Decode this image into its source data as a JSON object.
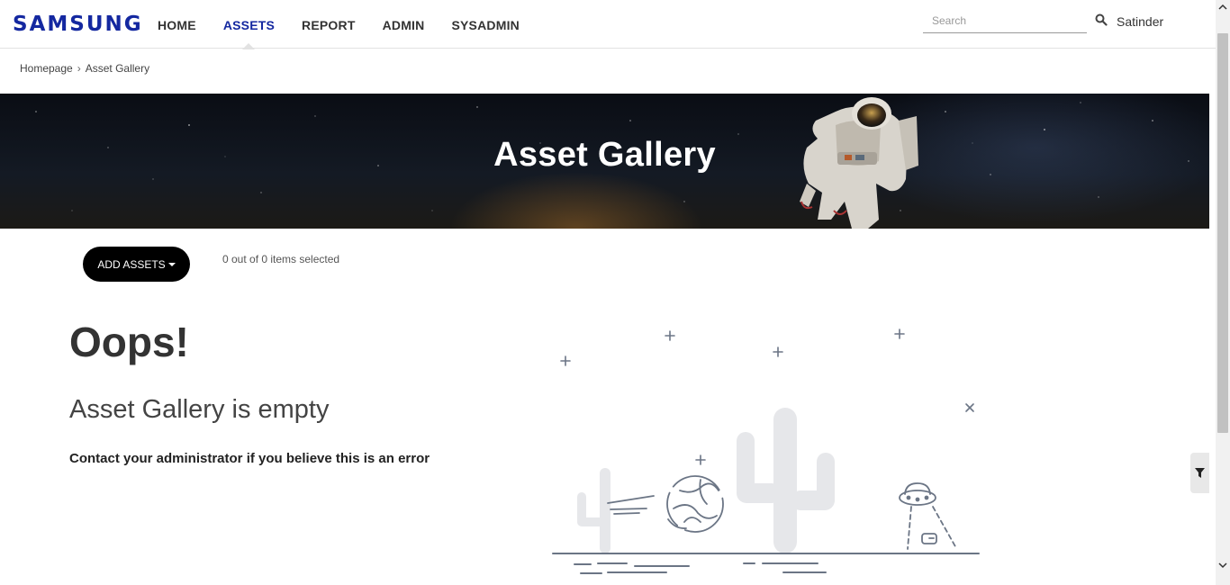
{
  "header": {
    "logo": "SAMSUNG",
    "nav": [
      {
        "label": "HOME",
        "active": false
      },
      {
        "label": "ASSETS",
        "active": true
      },
      {
        "label": "REPORT",
        "active": false
      },
      {
        "label": "ADMIN",
        "active": false
      },
      {
        "label": "SYSADMIN",
        "active": false
      }
    ],
    "search_placeholder": "Search",
    "user_name": "Satinder"
  },
  "breadcrumb": {
    "home": "Homepage",
    "separator": "›",
    "current": "Asset Gallery"
  },
  "banner": {
    "title": "Asset Gallery"
  },
  "toolbar": {
    "add_assets_label": "ADD ASSETS",
    "selected_count_text": "0 out of 0 items selected"
  },
  "empty_state": {
    "heading": "Oops!",
    "message": "Asset Gallery is empty",
    "hint": "Contact your administrator if you believe this is an error"
  },
  "colors": {
    "brand": "#1428a0",
    "button_bg": "#000000",
    "illustration_stroke": "#6b7585",
    "cactus_fill": "#e6e7ea"
  },
  "icons": {
    "search": "search-icon",
    "filter": "filter-icon",
    "caret": "caret-down-icon"
  }
}
